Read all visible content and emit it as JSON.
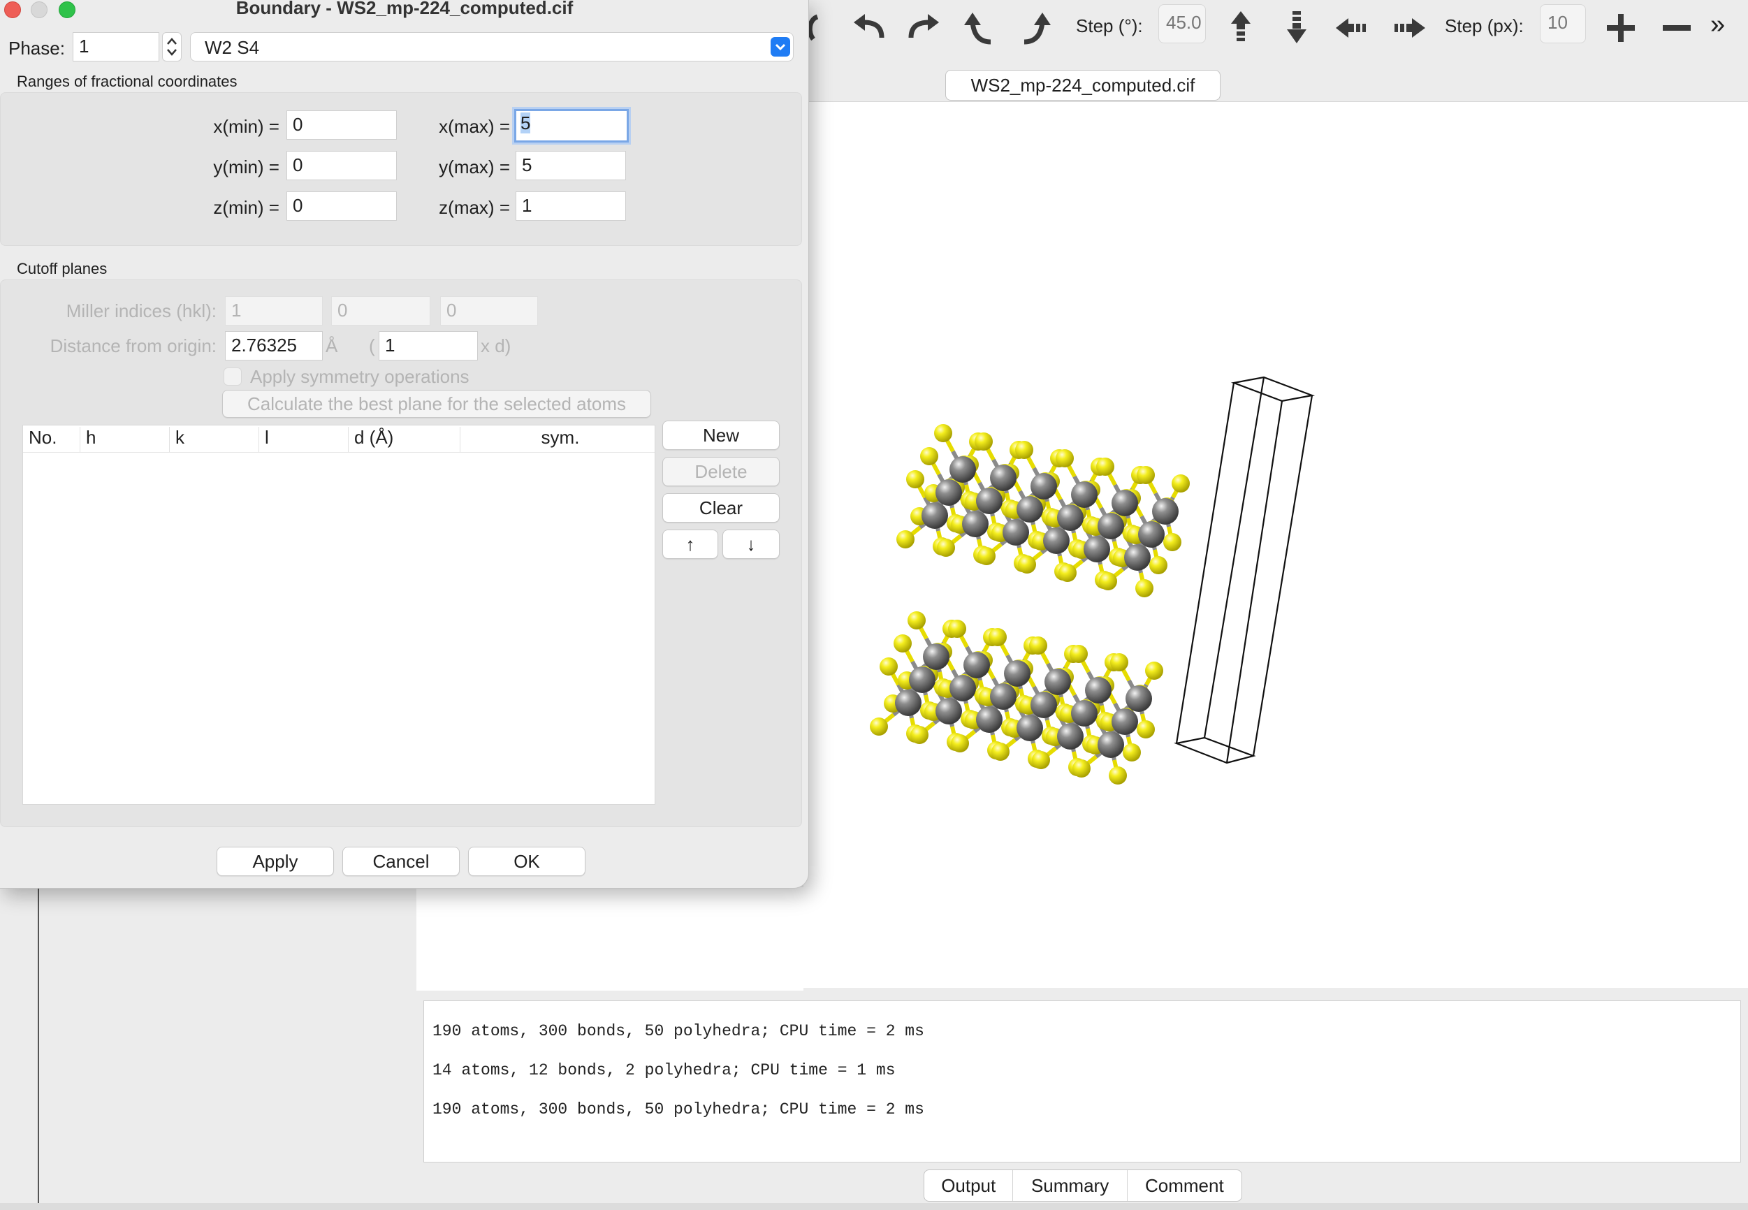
{
  "toolbar": {
    "icons": [
      "rotate-left-icon",
      "undo-icon",
      "redo-icon",
      "rotate-up-left-icon",
      "rotate-up-right-icon",
      "move-up-icon",
      "move-down-icon",
      "move-left-icon",
      "move-right-icon",
      "zoom-in-icon",
      "zoom-out-icon",
      "more-icon"
    ],
    "step_deg_label": "Step (°):",
    "step_deg_value": "45.0",
    "step_px_label": "Step (px):",
    "step_px_value": "10",
    "more_label": "»"
  },
  "document_tab": "WS2_mp-224_computed.cif",
  "log": {
    "lines": [
      "190 atoms, 300 bonds, 50 polyhedra; CPU time = 2 ms",
      "14 atoms, 12 bonds, 2 polyhedra; CPU time = 1 ms",
      "190 atoms, 300 bonds, 50 polyhedra; CPU time = 2 ms"
    ]
  },
  "bottom_tabs": [
    "Output",
    "Summary",
    "Comment"
  ],
  "dialog": {
    "title": "Boundary - WS2_mp-224_computed.cif",
    "phase_label": "Phase:",
    "phase_value": "1",
    "phase_name": "W2 S4",
    "ranges_label": "Ranges of fractional coordinates",
    "xmin_label": "x(min) =",
    "xmin": "0",
    "xmax_label": "x(max) =",
    "xmax": "5",
    "ymin_label": "y(min) =",
    "ymin": "0",
    "ymax_label": "y(max) =",
    "ymax": "5",
    "zmin_label": "z(min) =",
    "zmin": "0",
    "zmax_label": "z(max) =",
    "zmax": "1",
    "cutoff_label": "Cutoff planes",
    "miller_label": "Miller indices (hkl):",
    "miller_h": "1",
    "miller_k": "0",
    "miller_l": "0",
    "distance_label": "Distance from origin:",
    "distance_value": "2.76325",
    "distance_unit": "Å",
    "paren_open": "(",
    "multiplier_value": "1",
    "multiplier_suffix": "x d)",
    "symmetry_label": "Apply symmetry operations",
    "calc_plane_label": "Calculate the best plane for the selected atoms",
    "table_headers": [
      "No.",
      "h",
      "k",
      "l",
      "d (Å)",
      "sym."
    ],
    "new_label": "New",
    "delete_label": "Delete",
    "clear_label": "Clear",
    "up_label": "↑",
    "down_label": "↓",
    "apply_label": "Apply",
    "cancel_label": "Cancel",
    "ok_label": "OK"
  }
}
